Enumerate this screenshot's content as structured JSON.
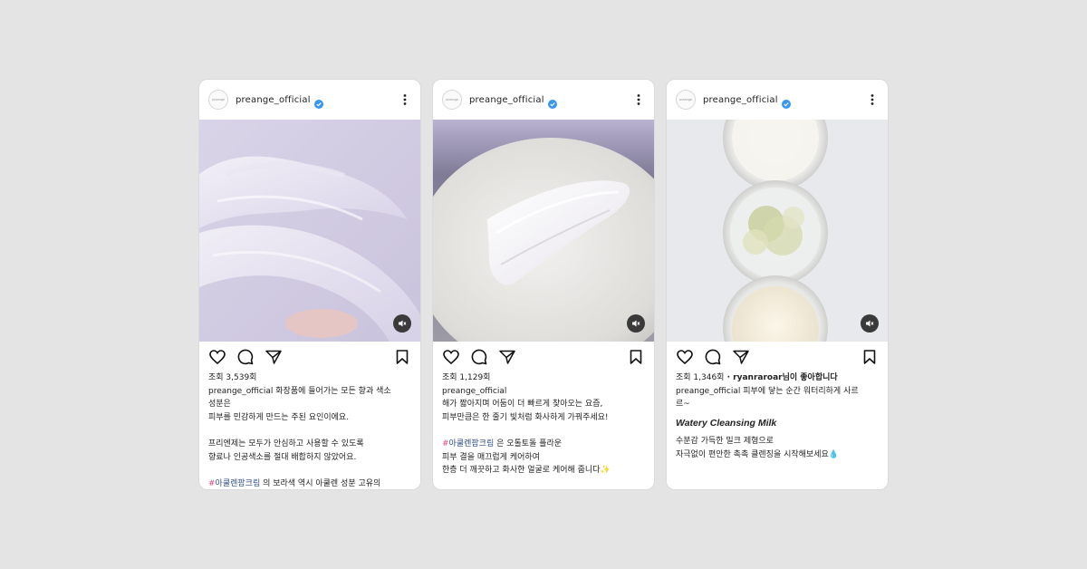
{
  "posts": [
    {
      "avatar_text": "preange",
      "username": "preange_official",
      "views": "조회 3,539회",
      "caption_user": "preange_official",
      "caption_first": "화장품에 들어가는 모든 향과 색소",
      "lines": [
        "성분은",
        "피부를 민감하게 만드는 주된 요인이에요."
      ],
      "lines2": [
        "프리엔제는 모두가 안심하고 사용할 수 있도록",
        "향료나 인공색소를 절대 배합하지 않았어요."
      ],
      "hashtag_symbol": "#",
      "hashtag_word": "아쿨렌팜크림",
      "hashtag_rest": " 의 보라색 역시 아쿨렌 성분 고유의"
    },
    {
      "avatar_text": "preange",
      "username": "preange_official",
      "views": "조회 1,129회",
      "caption_user": "preange_official",
      "lines": [
        "해가 짧아지며 어둠이 더 빠르게 찾아오는 요즘,",
        "피부만큼은 한 줄기 빛처럼 화사하게 가꿔주세요!"
      ],
      "hashtag_symbol": "#",
      "hashtag_word": "아쿨렌팜크림",
      "hashtag_rest": " 은 오톨토돌 플라운",
      "lines2": [
        "피부 결을 매끄럽게 케어하여",
        "한층 더 깨끗하고 화사한 얼굴로 케어해 줍니다✨"
      ]
    },
    {
      "avatar_text": "preange",
      "username": "preange_official",
      "views": "조회 1,346회",
      "liked_by": " · ryanraroar님이 좋아합니다",
      "caption_user": "preange_official",
      "caption_first": " 피부에 닿는 순간 워터리하게 사르",
      "caption_second": "르~",
      "title_en": "Watery Cleansing Milk",
      "lines2": [
        "수분감 가득한 밀크 제형으로",
        "자극없이 편안한 촉촉 클렌징을 시작해보세요💧"
      ]
    }
  ],
  "colors": {
    "background": "#e4e4e4",
    "card": "#ffffff",
    "verified": "#3897f0",
    "hashtag": "#e04a7f",
    "tag_link": "#2f4f88"
  },
  "icons": [
    "verified-badge-icon",
    "more-options-icon",
    "mute-icon",
    "heart-icon",
    "comment-icon",
    "share-icon",
    "bookmark-icon"
  ]
}
